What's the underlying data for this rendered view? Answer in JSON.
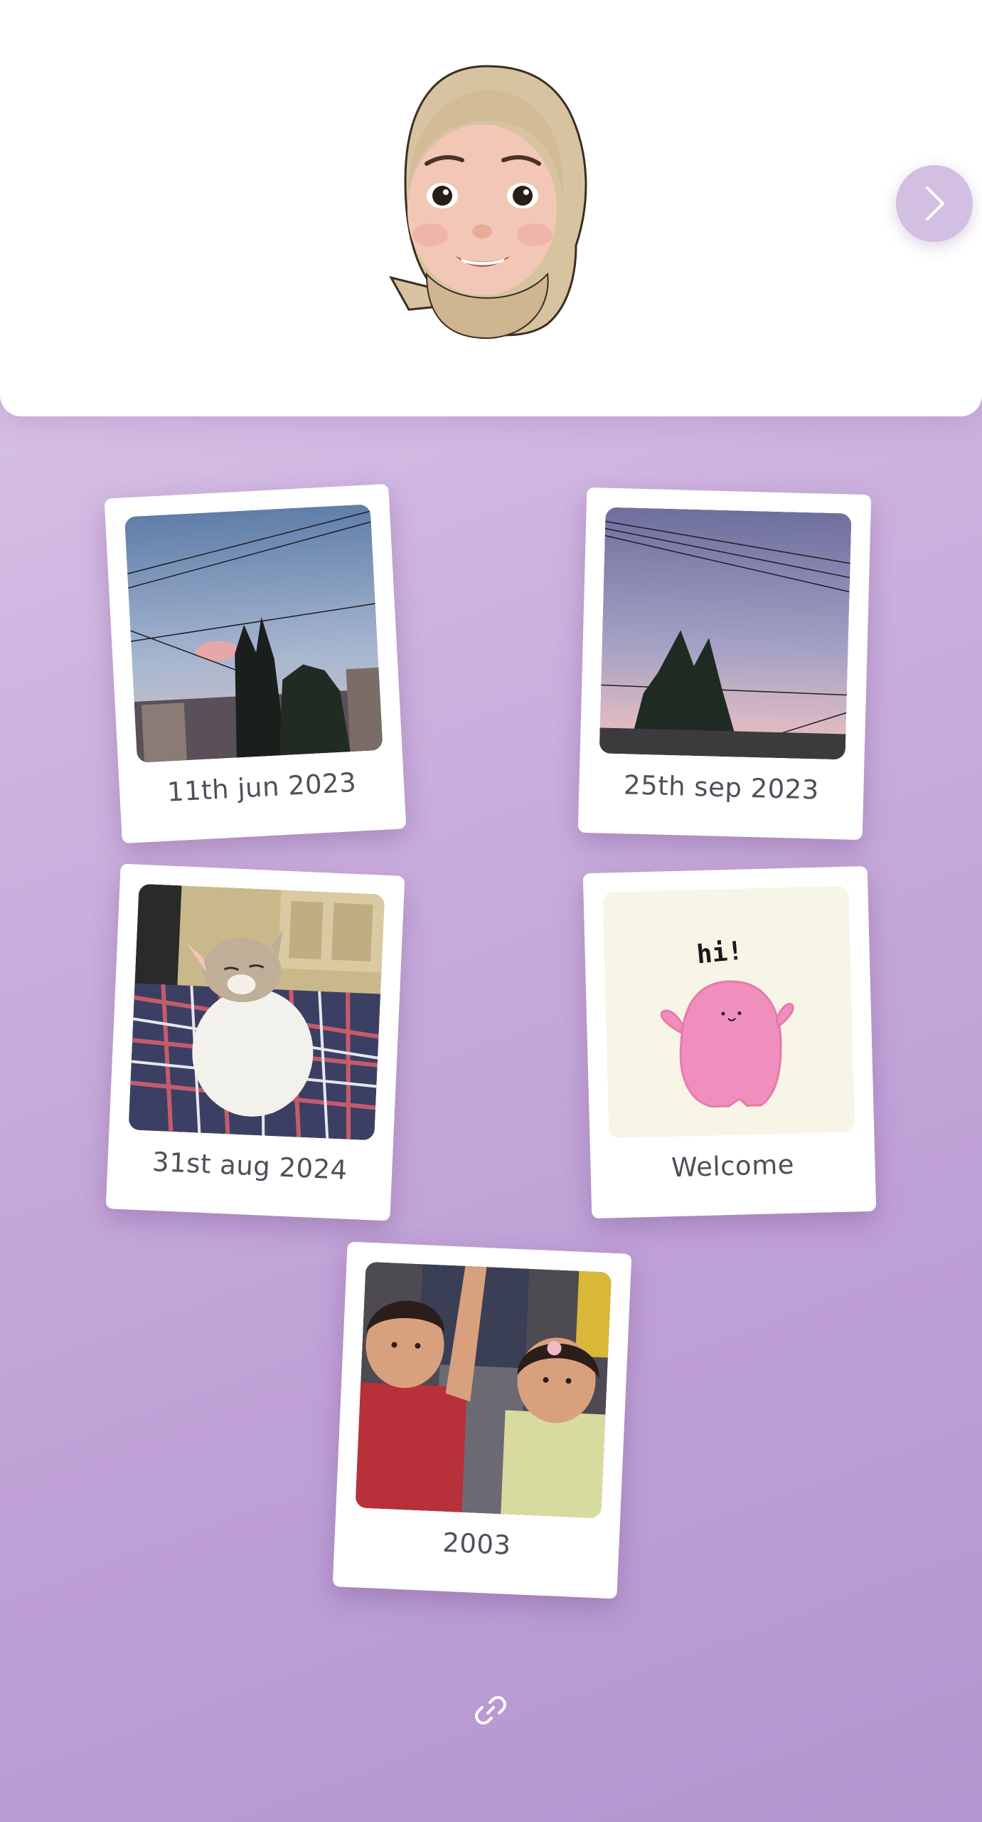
{
  "header": {
    "avatar_icon": "memoji-avatar-icon",
    "next_icon": "chevron-right-icon",
    "accent_color": "#d3bfe1"
  },
  "gallery": {
    "items": [
      {
        "caption": "11th jun 2023",
        "image": "sunset-trees-photo"
      },
      {
        "caption": "25th sep 2023",
        "image": "cypress-sky-photo"
      },
      {
        "caption": "31st aug 2024",
        "image": "sleeping-cat-photo"
      },
      {
        "caption": "Welcome",
        "image": "hi-pink-blob-illustration",
        "illustration_text": "hi!"
      },
      {
        "caption": "2003",
        "image": "childhood-photo"
      }
    ]
  },
  "footer": {
    "link_icon": "link-icon"
  }
}
